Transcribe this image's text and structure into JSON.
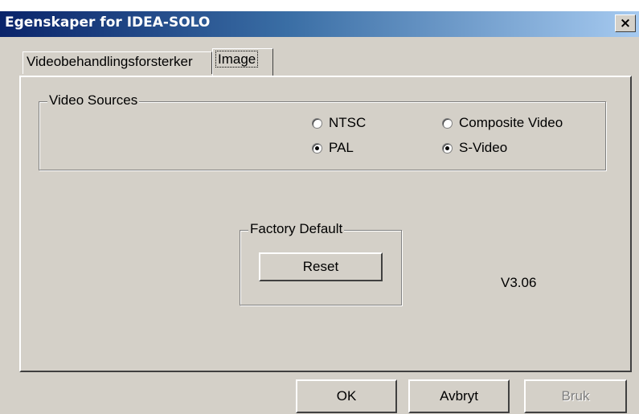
{
  "window": {
    "title": "Egenskaper for IDEA-SOLO",
    "close_label": "×"
  },
  "tabs": [
    {
      "label": "Videobehandlingsforsterker"
    },
    {
      "label": "Image"
    }
  ],
  "video_sources": {
    "legend": "Video Sources",
    "options": [
      {
        "label": "NTSC",
        "checked": false
      },
      {
        "label": "PAL",
        "checked": true
      },
      {
        "label": "Composite Video",
        "checked": false
      },
      {
        "label": "S-Video",
        "checked": true
      }
    ]
  },
  "factory_default": {
    "legend": "Factory Default",
    "reset_label": "Reset"
  },
  "version": "V3.06",
  "buttons": {
    "ok": "OK",
    "cancel": "Avbryt",
    "apply": "Bruk"
  }
}
